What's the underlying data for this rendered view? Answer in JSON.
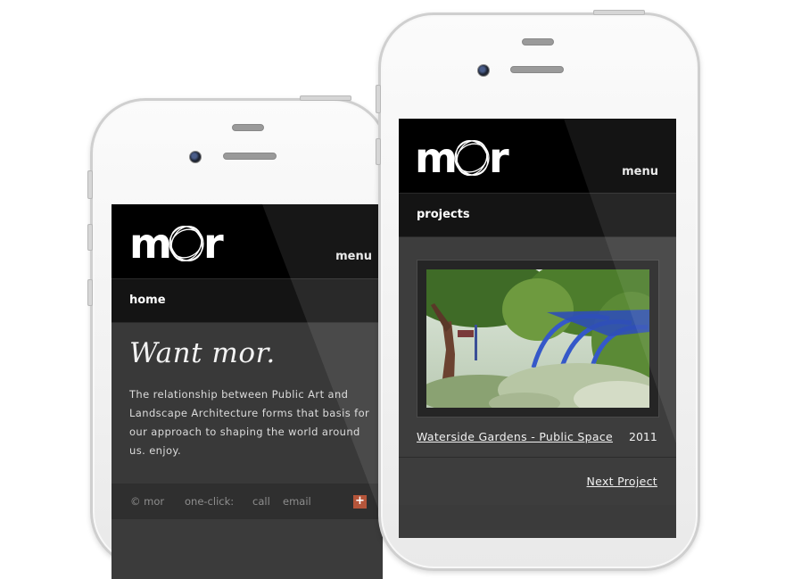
{
  "left_phone": {
    "logo_text": "mor",
    "menu_label": "menu",
    "nav_title": "home",
    "tagline": "Want mor.",
    "body_text": "The relationship between Public Art and Landscape Architecture forms that basis for our approach to shaping the world around us. enjoy.",
    "footer": {
      "copyright": "© mor",
      "one_click_label": "one-click:",
      "call_label": "call",
      "email_label": "email",
      "plus_label": "+"
    }
  },
  "right_phone": {
    "logo_text": "mor",
    "menu_label": "menu",
    "nav_title": "projects",
    "project_title": "Waterside Gardens - Public Space",
    "project_year": "2011",
    "next_label": "Next Project"
  },
  "colors": {
    "header_bg": "#000000",
    "content_bg": "#3a3a3a",
    "accent_plus": "#b5553a",
    "text_light": "#f1f1f1"
  }
}
